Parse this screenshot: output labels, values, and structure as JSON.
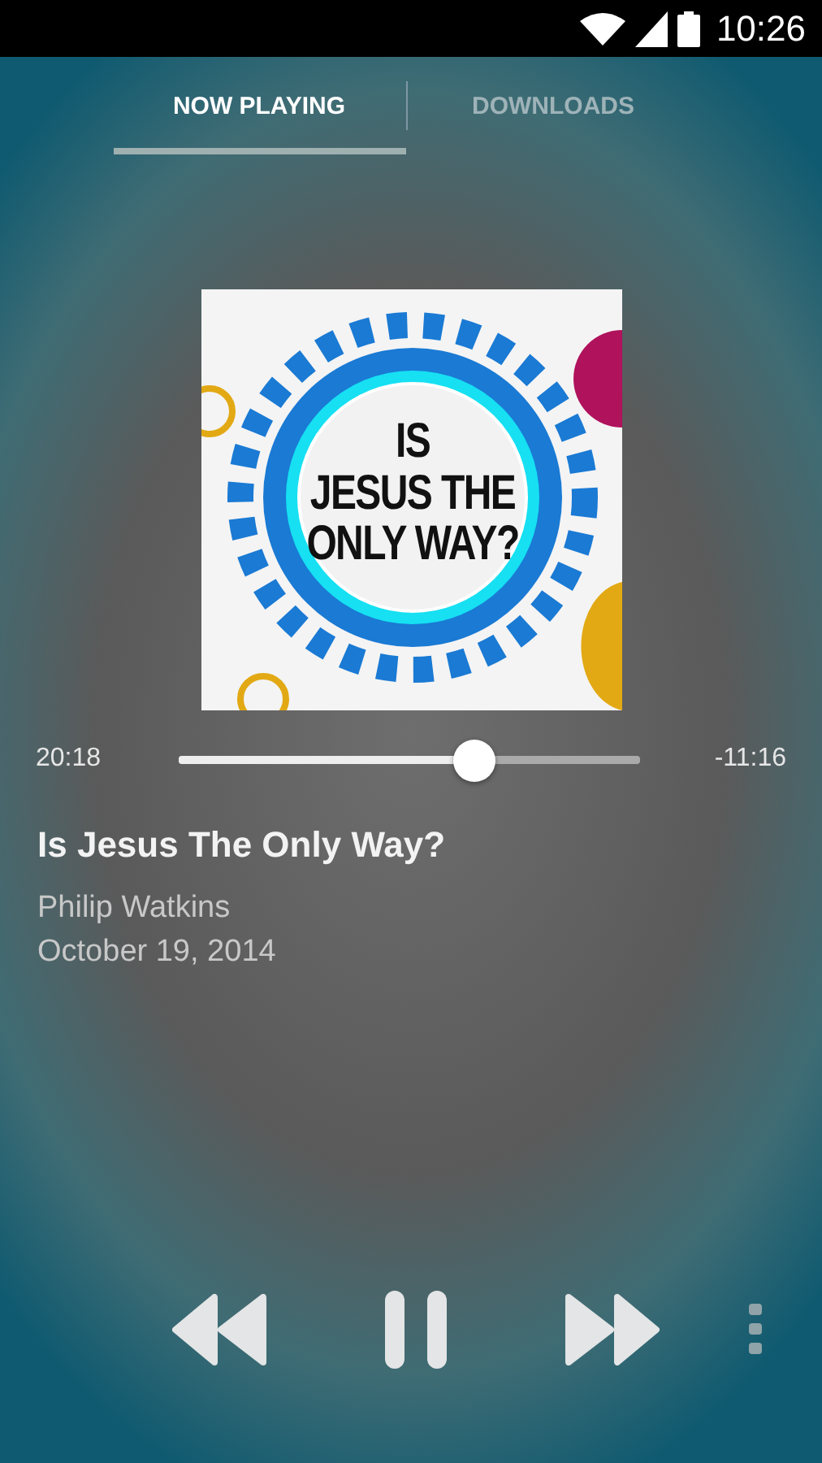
{
  "status_bar": {
    "time": "10:26"
  },
  "tabs": [
    {
      "label": "NOW PLAYING",
      "selected": true
    },
    {
      "label": "DOWNLOADS",
      "selected": false
    }
  ],
  "artwork": {
    "lines": [
      "IS",
      "JESUS THE",
      "ONLY WAY?"
    ]
  },
  "progress": {
    "elapsed": "20:18",
    "remaining": "-11:16",
    "level": 0.64
  },
  "track": {
    "title": "Is Jesus The Only Way?",
    "speaker": "Philip Watkins",
    "date": "October 19, 2014"
  },
  "controls": {
    "playing": true
  }
}
